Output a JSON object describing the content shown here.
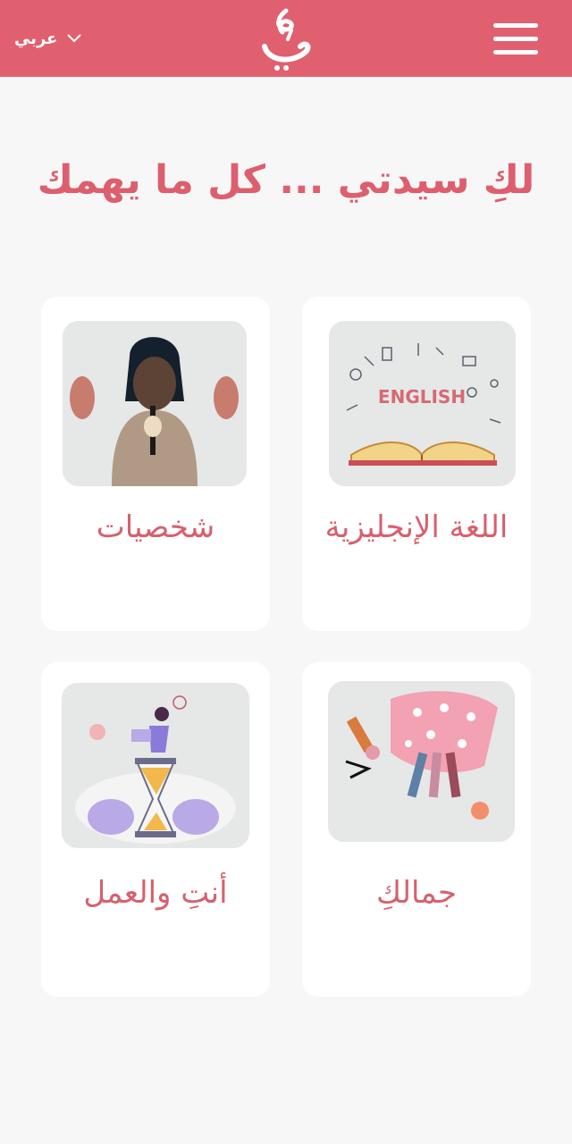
{
  "header": {
    "language_label": "عربي",
    "language_chevron_icon": "chevron-down-icon",
    "logo_icon": "calligraphy-logo-icon",
    "menu_icon": "hamburger-menu-icon",
    "brand_color": "#e06070"
  },
  "headline": "لكِ سيدتي ... كل ما يهمك",
  "cards": [
    {
      "title": "اللغة الإنجليزية",
      "image_text": "ENGLISH",
      "image_icon": "english-book-icon"
    },
    {
      "title": "شخصيات",
      "image_icon": "woman-with-masks-icon"
    },
    {
      "title": "جمالكِ",
      "image_icon": "makeup-cosmetics-icon"
    },
    {
      "title": "أنتِ والعمل",
      "image_icon": "hourglass-work-icon"
    }
  ],
  "colors": {
    "accent": "#dd5f6e",
    "card_background": "#ffffff",
    "page_background": "#f7f7f7"
  }
}
